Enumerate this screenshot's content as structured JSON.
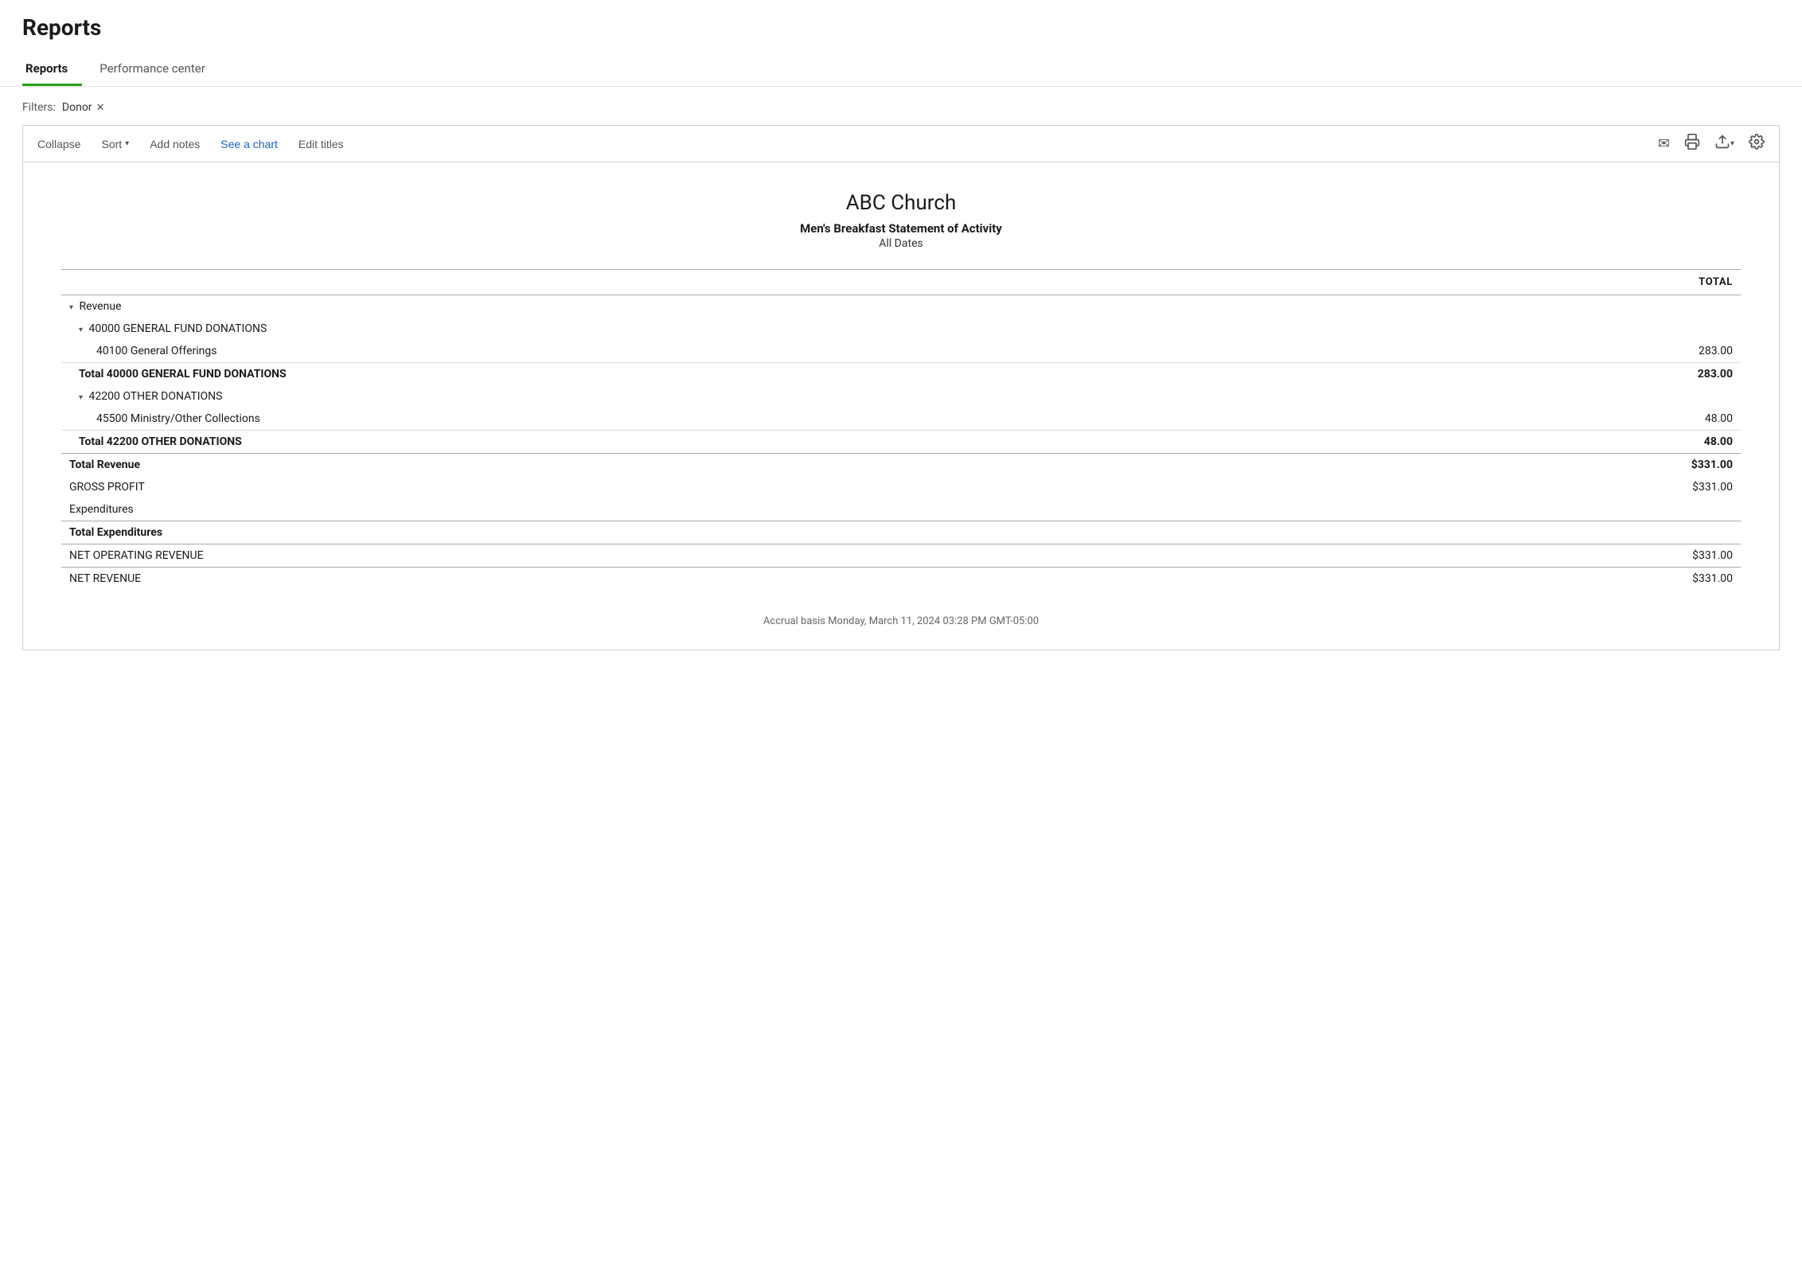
{
  "page": {
    "title": "Reports"
  },
  "tabs": [
    {
      "id": "reports",
      "label": "Reports",
      "active": true
    },
    {
      "id": "performance",
      "label": "Performance center",
      "active": false
    }
  ],
  "filters": {
    "label": "Filters:",
    "tags": [
      {
        "name": "Donor",
        "removable": true
      }
    ]
  },
  "toolbar": {
    "collapse_label": "Collapse",
    "sort_label": "Sort",
    "add_notes_label": "Add notes",
    "see_chart_label": "See a chart",
    "edit_titles_label": "Edit titles"
  },
  "icons": {
    "mail": "✉",
    "print": "⎙",
    "export": "↗",
    "settings": "⚙"
  },
  "report": {
    "org_name": "ABC Church",
    "subtitle": "Men's Breakfast Statement of Activity",
    "date_range": "All Dates",
    "columns": [
      {
        "label": ""
      },
      {
        "label": "TOTAL"
      }
    ],
    "rows": [
      {
        "type": "category",
        "indent": 0,
        "label": "Revenue",
        "value": "",
        "chevron": true
      },
      {
        "type": "category",
        "indent": 1,
        "label": "40000 GENERAL FUND DONATIONS",
        "value": "",
        "chevron": true
      },
      {
        "type": "item",
        "indent": 2,
        "label": "40100 General Offerings",
        "value": "283.00"
      },
      {
        "type": "total",
        "indent": 1,
        "label": "Total 40000 GENERAL FUND DONATIONS",
        "value": "283.00"
      },
      {
        "type": "category",
        "indent": 1,
        "label": "42200 OTHER DONATIONS",
        "value": "",
        "chevron": true
      },
      {
        "type": "item",
        "indent": 2,
        "label": "45500 Ministry/Other Collections",
        "value": "48.00"
      },
      {
        "type": "total",
        "indent": 1,
        "label": "Total 42200 OTHER DONATIONS",
        "value": "48.00"
      },
      {
        "type": "total-main",
        "indent": 0,
        "label": "Total Revenue",
        "value": "$331.00"
      },
      {
        "type": "plain",
        "indent": 0,
        "label": "GROSS PROFIT",
        "value": "$331.00"
      },
      {
        "type": "plain-novalue",
        "indent": 0,
        "label": "Expenditures",
        "value": ""
      },
      {
        "type": "total-main",
        "indent": 0,
        "label": "Total Expenditures",
        "value": ""
      },
      {
        "type": "net",
        "indent": 0,
        "label": "NET OPERATING REVENUE",
        "value": "$331.00"
      },
      {
        "type": "net",
        "indent": 0,
        "label": "NET REVENUE",
        "value": "$331.00"
      }
    ],
    "footer": "Accrual basis   Monday, March 11, 2024   03:28 PM GMT-05:00"
  }
}
